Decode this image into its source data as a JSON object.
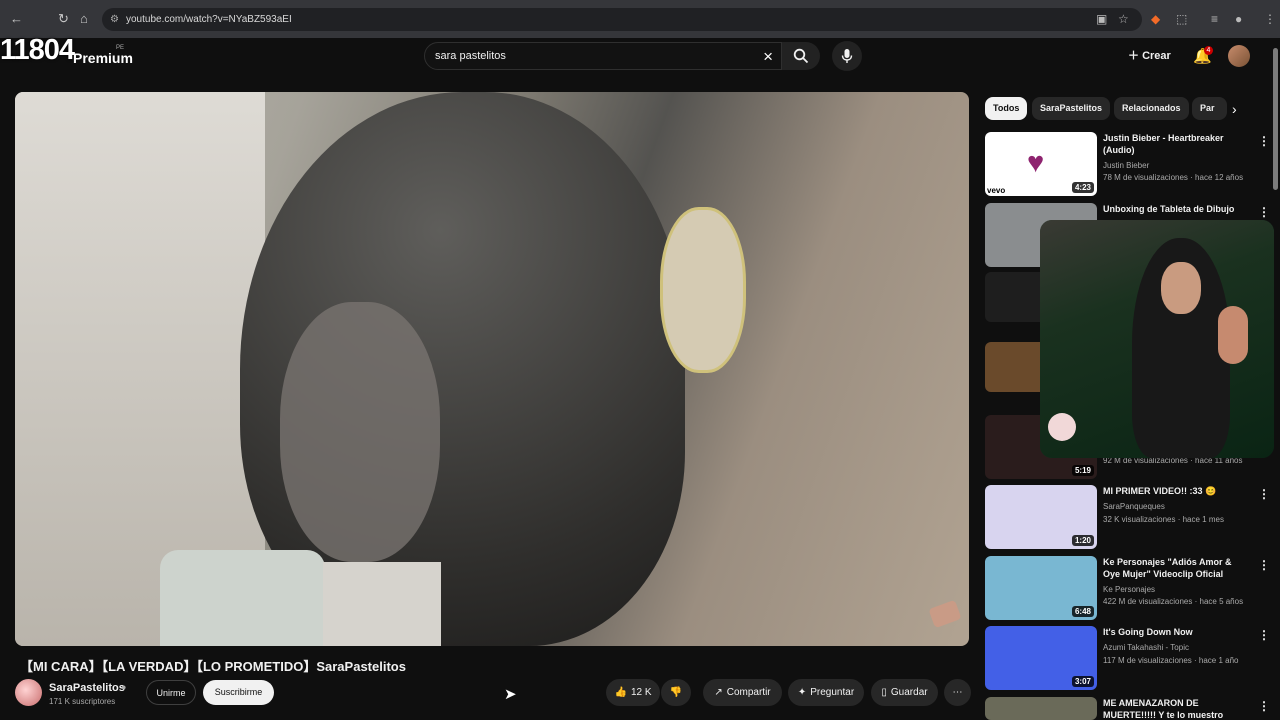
{
  "browser": {
    "url": "youtube.com/watch?v=NYaBZ593aEI"
  },
  "overlay": {
    "counter": "11804"
  },
  "header": {
    "logo_text": "Premium",
    "region_code": "PE",
    "search_value": "sara pastelitos",
    "create_label": "Crear",
    "notification_count": "4"
  },
  "video": {
    "title": "【MI CARA】【LA VERDAD】【LO PROMETIDO】SaraPastelitos",
    "channel_name": "SaraPastelitos",
    "subscribers": "171 K suscriptores",
    "join_label": "Unirme",
    "subscribe_label": "Suscribirme",
    "likes": "12 K",
    "share_label": "Compartir",
    "ask_label": "Preguntar",
    "save_label": "Guardar"
  },
  "chips": [
    "Todos",
    "SaraPastelitos",
    "Relacionados",
    "Par"
  ],
  "recommendations": [
    {
      "title": "Justin Bieber - Heartbreaker (Audio)",
      "channel": "Justin Bieber",
      "stats": "78 M de visualizaciones · hace 12 años",
      "duration": "4:23",
      "thumbnail_color": "#ffffff"
    },
    {
      "title": "Unboxing de Tableta de Dibujo",
      "thumbnail_color": "#8a8d8f"
    },
    {
      "stats": "92 M de visualizaciones · hace 11 años",
      "duration": "5:19",
      "thumbnail_color": "#2a1c1c"
    },
    {
      "title": "MI PRIMER VIDEO!! :33 😊",
      "channel": "SaraPanqueques",
      "stats": "32 K visualizaciones · hace 1 mes",
      "duration": "1:20",
      "thumbnail_color": "#d8d4ef"
    },
    {
      "title": "Ke Personajes \"Adiós Amor & Oye Mujer\" Videoclip Oficial",
      "channel": "Ke Personajes",
      "stats": "422 M de visualizaciones · hace 5 años",
      "duration": "6:48",
      "thumbnail_color": "#79b7d2"
    },
    {
      "title": "It's Going Down Now",
      "channel": "Azumi Takahashi - Topic",
      "stats": "117 M de visualizaciones · hace 1 año",
      "duration": "3:07",
      "thumbnail_color": "#4360e7"
    },
    {
      "title": "ME AMENAZARON DE MUERTE!!!!! Y te lo muestro",
      "thumbnail_color": "#6a6a59"
    }
  ]
}
